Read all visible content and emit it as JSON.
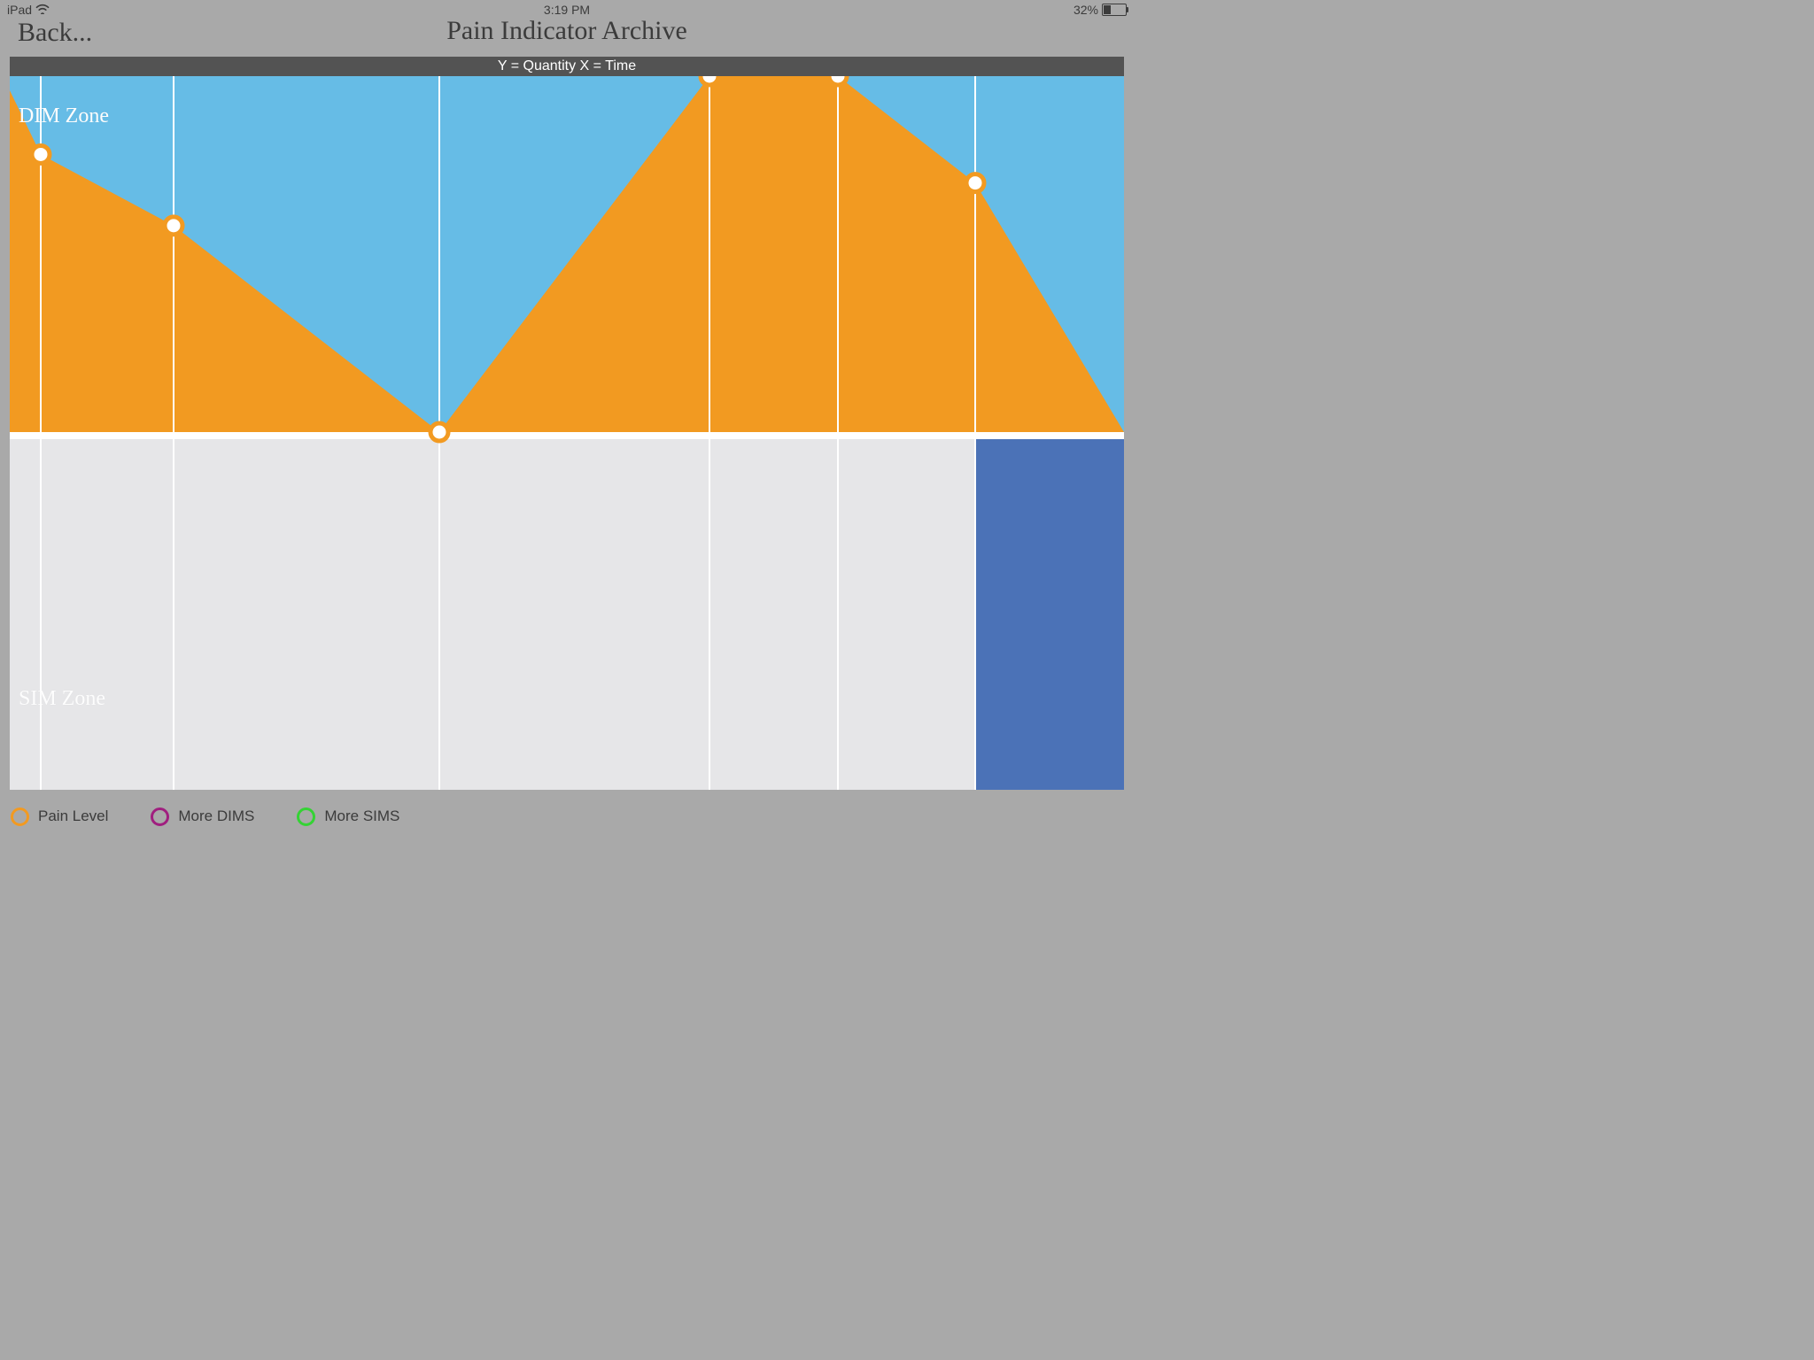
{
  "statusbar": {
    "device": "iPad",
    "time": "3:19 PM",
    "battery_pct": "32%",
    "battery_fill_pct": 32
  },
  "header": {
    "back_label": "Back...",
    "title": "Pain Indicator Archive"
  },
  "axis_band_text": "Y = Quantity    X = Time",
  "zones": {
    "top_label": "DIM Zone",
    "bottom_label": "SIM Zone"
  },
  "colors": {
    "sky": "#66bce6",
    "orange": "#f29a21",
    "lightgray": "#e6e6e8",
    "darkblue": "#4b72b7",
    "magenta": "#a01f7f",
    "green": "#34d334",
    "gridline": "#ffffff"
  },
  "legend": [
    {
      "key": "pain",
      "label": "Pain Level",
      "color": "#f29a21"
    },
    {
      "key": "dims",
      "label": "More DIMS",
      "color": "#a01f7f"
    },
    {
      "key": "sims",
      "label": "More SIMS",
      "color": "#34d334"
    }
  ],
  "chart_data": {
    "type": "area",
    "title": "Pain Indicator Archive",
    "xlabel": "Time",
    "ylabel": "Quantity",
    "ylim": [
      -100,
      100
    ],
    "annotations": [
      "DIM Zone (upper)",
      "SIM Zone (lower)"
    ],
    "entries": [
      {
        "pain": 78,
        "sim_present": false,
        "grid_x": 35
      },
      {
        "pain": 58,
        "sim_present": false,
        "grid_x": 185
      },
      {
        "pain": 0,
        "sim_present": false,
        "grid_x": 485
      },
      {
        "pain": 100,
        "sim_present": false,
        "grid_x": 790
      },
      {
        "pain": 100,
        "sim_present": false,
        "grid_x": 935
      },
      {
        "pain": 70,
        "sim_present": true,
        "sim_x_start": 1090,
        "grid_x": 1090
      }
    ],
    "left_edge_pain": 96,
    "right_edge_pain_trail_x": 1258
  }
}
